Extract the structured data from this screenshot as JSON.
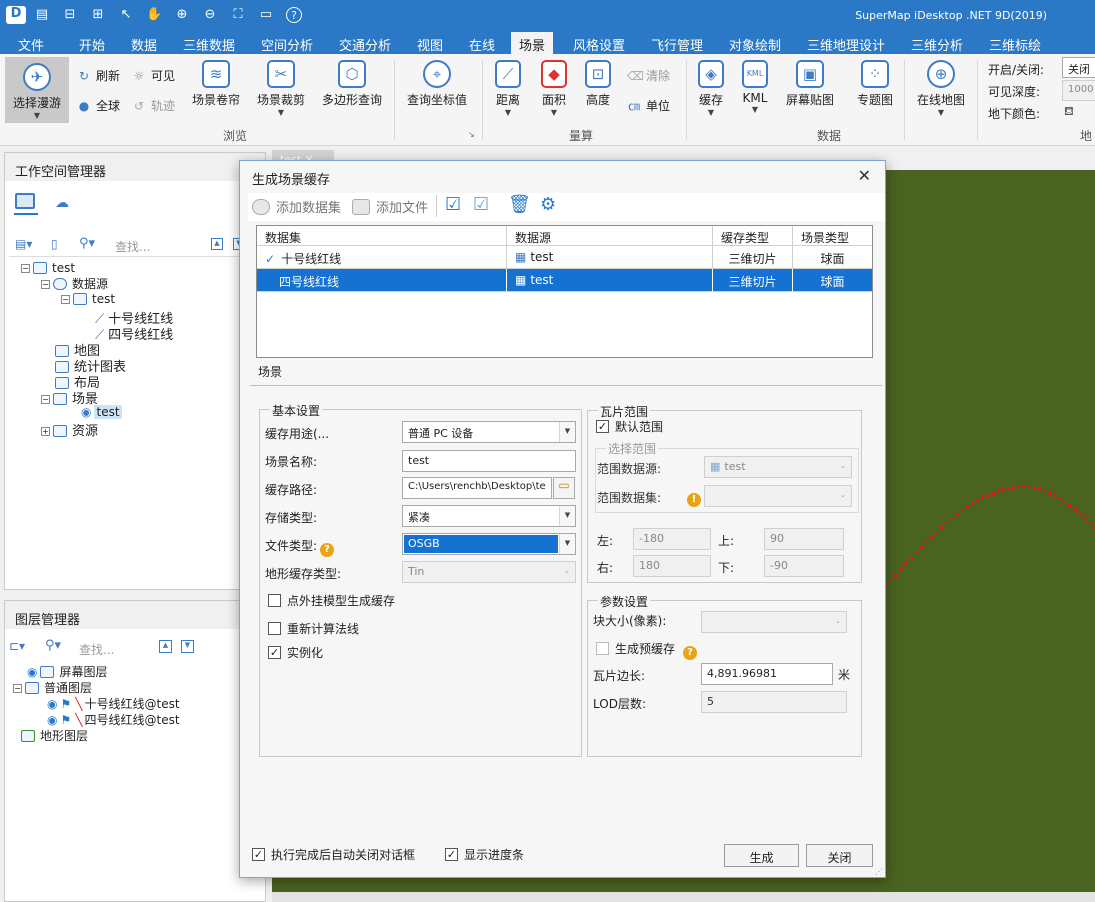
{
  "titlebar": {
    "app_title": "SuperMap iDesktop .NET 9D(2019)",
    "quick_access": [
      "save-icon",
      "open-icon",
      "restore-icon",
      "pointer-icon",
      "pan-icon",
      "zoom-in-icon",
      "zoom-out-icon",
      "full-extent-icon",
      "folder-icon",
      "help-icon"
    ],
    "help_glyph": "?"
  },
  "menu": [
    "文件",
    "开始",
    "数据",
    "三维数据",
    "空间分析",
    "交通分析",
    "视图",
    "在线",
    "场景",
    "风格设置",
    "飞行管理",
    "对象绘制",
    "三维地理设计",
    "三维分析",
    "三维标绘"
  ],
  "ribbon": {
    "browse": {
      "nav": "选择漫游",
      "refresh": "刷新",
      "visible": "可见",
      "globe": "全球",
      "track": "轨迹",
      "scroll": "场景卷帘",
      "clip": "场景裁剪",
      "polygon_query": "多边形查询",
      "coord_query": "查询坐标值",
      "group": "浏览"
    },
    "measure": {
      "distance": "距离",
      "area": "面积",
      "height": "高度",
      "clear": "清除",
      "unit": "单位",
      "group": "量算"
    },
    "data": {
      "cache": "缓存",
      "kml": "KML",
      "screen_map": "屏幕贴图",
      "thematic": "专题图",
      "online_map": "在线地图",
      "group": "数据"
    },
    "underground": {
      "toggle_label": "开启/关闭:",
      "toggle_value": "关闭",
      "depth_label": "可见深度:",
      "depth_value": "1000",
      "color_label": "地下颜色:",
      "group": "地"
    },
    "kml_badge": "KML"
  },
  "workspace": {
    "title": "工作空间管理器",
    "search_placeholder": "查找...",
    "tree": {
      "root": "test",
      "datasource": "数据源",
      "ds_test": "test",
      "line10": "十号线红线",
      "line4": "四号线红线",
      "maps": "地图",
      "charts": "统计图表",
      "layouts": "布局",
      "scenes": "场景",
      "scene_test": "test",
      "resources": "资源"
    }
  },
  "layers": {
    "title": "图层管理器",
    "search_placeholder": "查找...",
    "screen_layer": "屏幕图层",
    "normal_layer": "普通图层",
    "layer1": "十号线红线@test",
    "layer2": "四号线红线@test",
    "terrain_layer": "地形图层"
  },
  "doc_tab": "test",
  "dialog": {
    "title": "生成场景缓存",
    "toolbar": {
      "add_dataset": "添加数据集",
      "add_file": "添加文件"
    },
    "grid": {
      "headers": [
        "数据集",
        "数据源",
        "缓存类型",
        "场景类型"
      ],
      "rows": [
        [
          "十号线红线",
          "test",
          "三维切片",
          "球面"
        ],
        [
          "四号线红线",
          "test",
          "三维切片",
          "球面"
        ]
      ],
      "check": "✓"
    },
    "tab": "场景",
    "basic": {
      "legend": "基本设置",
      "purpose_label": "缓存用途(...",
      "purpose_value": "普通 PC 设备",
      "name_label": "场景名称:",
      "name_value": "test",
      "path_label": "缓存路径:",
      "path_value": "C:\\Users\\renchb\\Desktop\\te",
      "storage_label": "存储类型:",
      "storage_value": "紧凑",
      "filetype_label": "文件类型:",
      "filetype_value": "OSGB",
      "terrain_label": "地形缓存类型:",
      "terrain_value": "Tin",
      "cb_point": "点外挂模型生成缓存",
      "cb_normal": "重新计算法线",
      "cb_instance": "实例化"
    },
    "tile_range": {
      "legend": "瓦片范围",
      "default_range": "默认范围",
      "select_range": "选择范围",
      "range_ds_label": "范围数据源:",
      "range_ds_value": "test",
      "range_dataset_label": "范围数据集:",
      "left_label": "左:",
      "left": "-180",
      "top_label": "上:",
      "top": "90",
      "right_label": "右:",
      "right": "180",
      "bottom_label": "下:",
      "bottom": "-90"
    },
    "params": {
      "legend": "参数设置",
      "block_size_label": "块大小(像素):",
      "pre_cache": "生成预缓存",
      "tile_edge_label": "瓦片边长:",
      "tile_edge": "4,891.96981",
      "tile_edge_unit": "米",
      "lod_label": "LOD层数:",
      "lod": "5"
    },
    "footer": {
      "auto_close": "执行完成后自动关闭对话框",
      "show_progress": "显示进度条",
      "generate": "生成",
      "close": "关闭"
    }
  },
  "colors": {
    "accent": "#2b79c6",
    "selection": "#1572d0",
    "map_bg": "#4a6320",
    "line": "#e8141c"
  }
}
